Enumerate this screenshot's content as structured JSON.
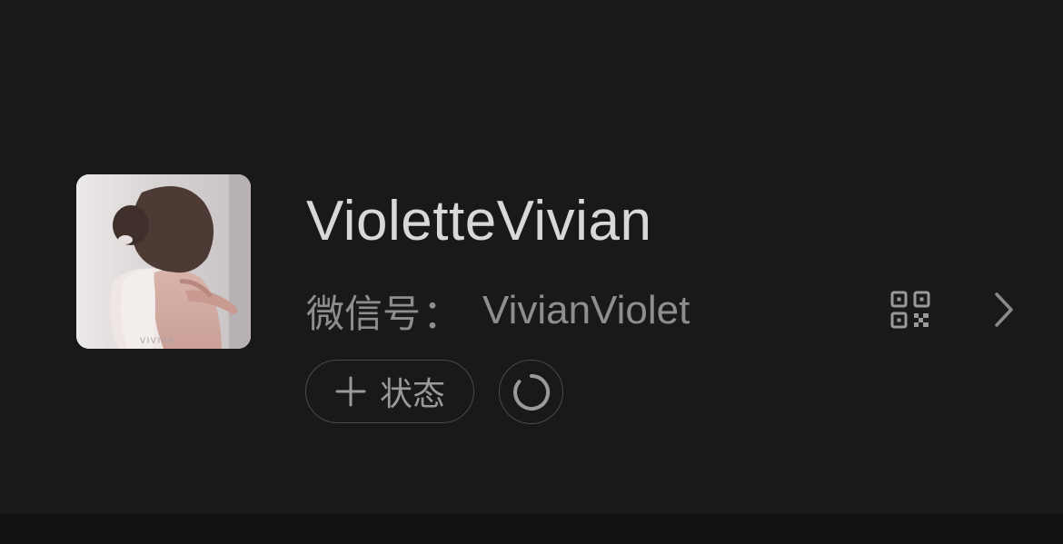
{
  "profile": {
    "nickname": "VioletteVivian",
    "wechat_id_label": "微信号",
    "wechat_id_colon": "：",
    "wechat_id": "VivianViolet",
    "avatar_watermark": "VIVIAN"
  },
  "actions": {
    "status_label": "状态",
    "status_icon": "plus-icon",
    "refresh_icon": "loading-ring-icon",
    "qr_icon": "qr-code-icon",
    "chevron_icon": "chevron-right-icon"
  },
  "colors": {
    "background": "#191919",
    "nickname": "#d8d8d8",
    "secondary_text": "#8e8e8e",
    "border": "#4a4a4a"
  }
}
